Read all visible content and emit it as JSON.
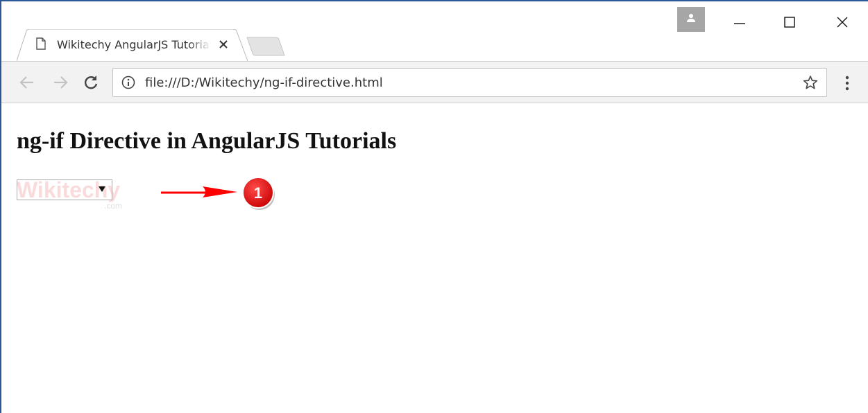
{
  "browser": {
    "tab": {
      "title": "Wikitechy AngularJS Tutorials",
      "icon": "page-icon"
    },
    "address_bar": {
      "url": "file:///D:/Wikitechy/ng-if-directive.html",
      "icon": "info-icon"
    },
    "window_controls": [
      "minimize-icon",
      "maximize-icon",
      "close-icon"
    ]
  },
  "page": {
    "heading": "ng-if Directive in AngularJS Tutorials",
    "select": {
      "selected": ""
    },
    "watermark": "Wikitechy",
    "watermark_domain": ".com"
  },
  "annotation": {
    "badge": "1",
    "color": "#ff0000"
  }
}
